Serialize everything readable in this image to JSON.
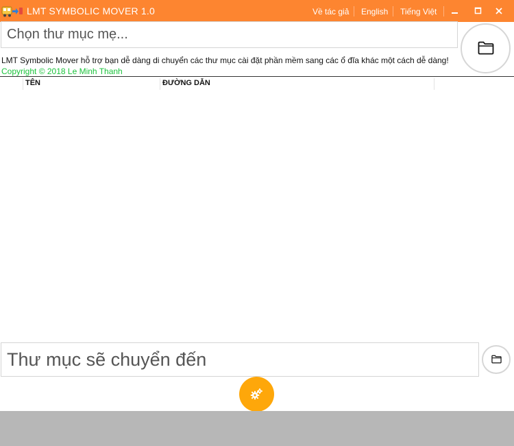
{
  "window": {
    "title": "LMT SYMBOLIC MOVER 1.0",
    "menu": {
      "about": "Về tác giả",
      "english": "English",
      "vietnamese": "Tiếng Việt"
    },
    "controls": [
      "minimize",
      "maximize",
      "close"
    ]
  },
  "parent_folder": {
    "placeholder": "Chọn thư mục mẹ...",
    "browse_icon": "folder-icon"
  },
  "info": {
    "description": "LMT Symbolic Mover hỗ trợ bạn dễ dàng di chuyển các thư mục cài đặt phần mềm sang các ổ đĩa khác một cách dễ dàng!",
    "copyright": "Copyright © 2018 Le Minh Thanh"
  },
  "table": {
    "columns": [
      "TÊN",
      "ĐƯỜNG DẪN"
    ],
    "rows": []
  },
  "destination": {
    "placeholder": "Thư mục sẽ chuyển đến",
    "browse_icon": "folder-icon"
  },
  "action": {
    "icon": "gears-icon"
  },
  "colors": {
    "titlebar": "#fd8530",
    "accent_button": "#fea70a",
    "copyright_text": "#19c23a",
    "footer": "#b7b7b7"
  }
}
